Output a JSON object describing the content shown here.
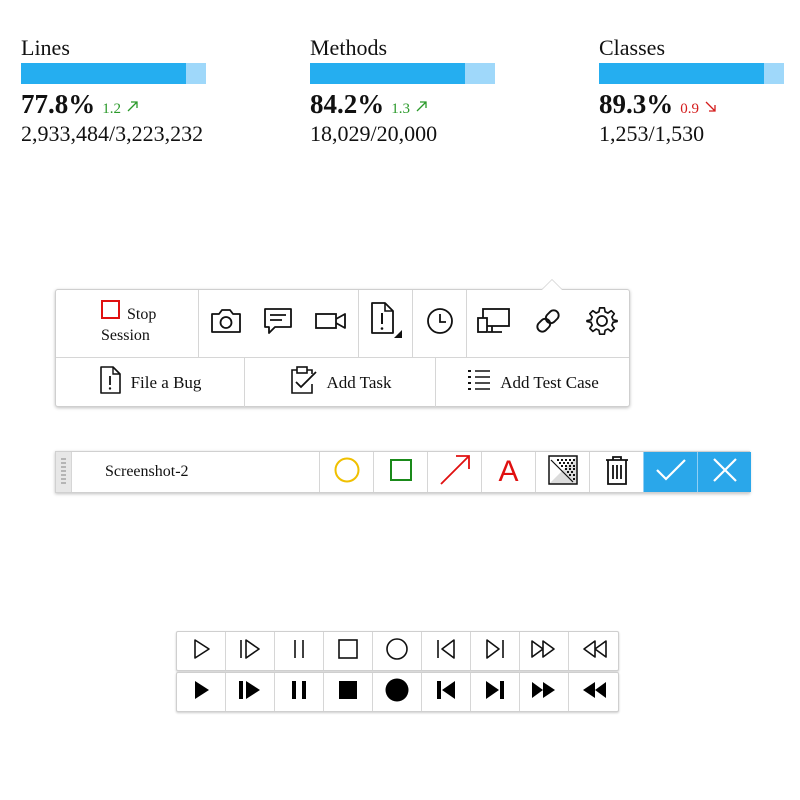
{
  "metrics": [
    {
      "label": "Lines",
      "percent": "77.8%",
      "fill": 0.89,
      "delta": "1.2",
      "trend": "up",
      "ratio": "2,933,484/3,223,232"
    },
    {
      "label": "Methods",
      "percent": "84.2%",
      "fill": 0.84,
      "delta": "1.3",
      "trend": "up",
      "ratio": "18,029/20,000"
    },
    {
      "label": "Classes",
      "percent": "89.3%",
      "fill": 0.89,
      "delta": "0.9",
      "trend": "down",
      "ratio": "1,253/1,530"
    }
  ],
  "session_toolbar": {
    "stop_line1": "Stop",
    "stop_line2": "Session",
    "icons": [
      "camera-icon",
      "comment-icon",
      "video-icon",
      "file-warning-icon",
      "clock-icon",
      "monitor-icon",
      "link-icon",
      "gear-icon"
    ],
    "actions": [
      {
        "label": "File a Bug",
        "icon": "file-warning-icon"
      },
      {
        "label": "Add Task",
        "icon": "clipboard-check-icon"
      },
      {
        "label": "Add Test Case",
        "icon": "list-icon"
      }
    ]
  },
  "annotation_bar": {
    "name": "Screenshot-2",
    "tools": [
      "ellipse-icon",
      "rectangle-icon",
      "arrow-icon",
      "text-icon",
      "blur-icon",
      "trash-icon",
      "confirm-icon",
      "cancel-icon"
    ],
    "colors": {
      "ellipse": "#f0c000",
      "rectangle": "#1a8a1a",
      "arrow": "#e01010",
      "text": "#e01010",
      "accent": "#2aa7ea"
    },
    "text_tool_label": "A"
  },
  "media_controls": {
    "outline": [
      "play",
      "step-forward",
      "pause",
      "stop",
      "record",
      "skip-back",
      "skip-forward",
      "fast-forward",
      "rewind"
    ],
    "filled": [
      "play",
      "step-forward",
      "pause",
      "stop",
      "record",
      "skip-back",
      "skip-forward",
      "fast-forward",
      "rewind"
    ]
  }
}
